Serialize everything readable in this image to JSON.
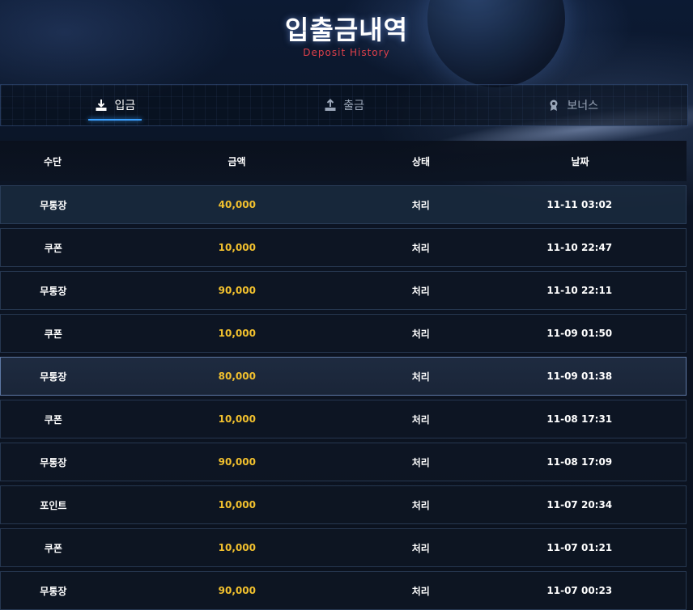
{
  "header": {
    "title": "입출금내역",
    "subtitle": "Deposit History"
  },
  "tabs": [
    {
      "label": "입금",
      "icon": "download-icon",
      "active": true
    },
    {
      "label": "출금",
      "icon": "upload-icon",
      "active": false
    },
    {
      "label": "보너스",
      "icon": "award-icon",
      "active": false
    }
  ],
  "table": {
    "columns": [
      "수단",
      "금액",
      "상태",
      "날짜"
    ],
    "rows": [
      {
        "method": "무통장",
        "amount": "40,000",
        "status": "처리",
        "date": "11-11 03:02"
      },
      {
        "method": "쿠폰",
        "amount": "10,000",
        "status": "처리",
        "date": "11-10 22:47"
      },
      {
        "method": "무통장",
        "amount": "90,000",
        "status": "처리",
        "date": "11-10 22:11"
      },
      {
        "method": "쿠폰",
        "amount": "10,000",
        "status": "처리",
        "date": "11-09 01:50"
      },
      {
        "method": "무통장",
        "amount": "80,000",
        "status": "처리",
        "date": "11-09 01:38"
      },
      {
        "method": "쿠폰",
        "amount": "10,000",
        "status": "처리",
        "date": "11-08 17:31"
      },
      {
        "method": "무통장",
        "amount": "90,000",
        "status": "처리",
        "date": "11-08 17:09"
      },
      {
        "method": "포인트",
        "amount": "10,000",
        "status": "처리",
        "date": "11-07 20:34"
      },
      {
        "method": "쿠폰",
        "amount": "10,000",
        "status": "처리",
        "date": "11-07 01:21"
      },
      {
        "method": "무통장",
        "amount": "90,000",
        "status": "처리",
        "date": "11-07 00:23"
      }
    ]
  },
  "colors": {
    "amount": "#f2c12e",
    "subtitle": "#e0404a",
    "tab_accent": "#3aa0ff"
  }
}
